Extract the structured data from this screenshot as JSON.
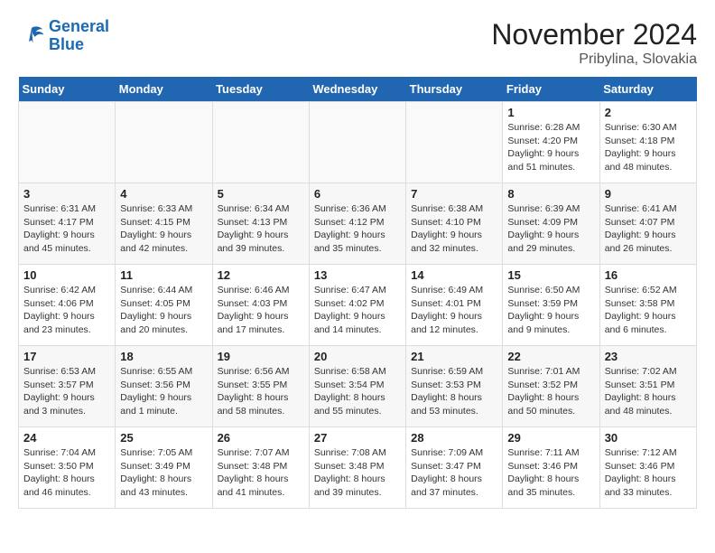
{
  "header": {
    "logo_line1": "General",
    "logo_line2": "Blue",
    "month_year": "November 2024",
    "location": "Pribylina, Slovakia"
  },
  "columns": [
    "Sunday",
    "Monday",
    "Tuesday",
    "Wednesday",
    "Thursday",
    "Friday",
    "Saturday"
  ],
  "weeks": [
    [
      {
        "day": "",
        "info": ""
      },
      {
        "day": "",
        "info": ""
      },
      {
        "day": "",
        "info": ""
      },
      {
        "day": "",
        "info": ""
      },
      {
        "day": "",
        "info": ""
      },
      {
        "day": "1",
        "info": "Sunrise: 6:28 AM\nSunset: 4:20 PM\nDaylight: 9 hours\nand 51 minutes."
      },
      {
        "day": "2",
        "info": "Sunrise: 6:30 AM\nSunset: 4:18 PM\nDaylight: 9 hours\nand 48 minutes."
      }
    ],
    [
      {
        "day": "3",
        "info": "Sunrise: 6:31 AM\nSunset: 4:17 PM\nDaylight: 9 hours\nand 45 minutes."
      },
      {
        "day": "4",
        "info": "Sunrise: 6:33 AM\nSunset: 4:15 PM\nDaylight: 9 hours\nand 42 minutes."
      },
      {
        "day": "5",
        "info": "Sunrise: 6:34 AM\nSunset: 4:13 PM\nDaylight: 9 hours\nand 39 minutes."
      },
      {
        "day": "6",
        "info": "Sunrise: 6:36 AM\nSunset: 4:12 PM\nDaylight: 9 hours\nand 35 minutes."
      },
      {
        "day": "7",
        "info": "Sunrise: 6:38 AM\nSunset: 4:10 PM\nDaylight: 9 hours\nand 32 minutes."
      },
      {
        "day": "8",
        "info": "Sunrise: 6:39 AM\nSunset: 4:09 PM\nDaylight: 9 hours\nand 29 minutes."
      },
      {
        "day": "9",
        "info": "Sunrise: 6:41 AM\nSunset: 4:07 PM\nDaylight: 9 hours\nand 26 minutes."
      }
    ],
    [
      {
        "day": "10",
        "info": "Sunrise: 6:42 AM\nSunset: 4:06 PM\nDaylight: 9 hours\nand 23 minutes."
      },
      {
        "day": "11",
        "info": "Sunrise: 6:44 AM\nSunset: 4:05 PM\nDaylight: 9 hours\nand 20 minutes."
      },
      {
        "day": "12",
        "info": "Sunrise: 6:46 AM\nSunset: 4:03 PM\nDaylight: 9 hours\nand 17 minutes."
      },
      {
        "day": "13",
        "info": "Sunrise: 6:47 AM\nSunset: 4:02 PM\nDaylight: 9 hours\nand 14 minutes."
      },
      {
        "day": "14",
        "info": "Sunrise: 6:49 AM\nSunset: 4:01 PM\nDaylight: 9 hours\nand 12 minutes."
      },
      {
        "day": "15",
        "info": "Sunrise: 6:50 AM\nSunset: 3:59 PM\nDaylight: 9 hours\nand 9 minutes."
      },
      {
        "day": "16",
        "info": "Sunrise: 6:52 AM\nSunset: 3:58 PM\nDaylight: 9 hours\nand 6 minutes."
      }
    ],
    [
      {
        "day": "17",
        "info": "Sunrise: 6:53 AM\nSunset: 3:57 PM\nDaylight: 9 hours\nand 3 minutes."
      },
      {
        "day": "18",
        "info": "Sunrise: 6:55 AM\nSunset: 3:56 PM\nDaylight: 9 hours\nand 1 minute."
      },
      {
        "day": "19",
        "info": "Sunrise: 6:56 AM\nSunset: 3:55 PM\nDaylight: 8 hours\nand 58 minutes."
      },
      {
        "day": "20",
        "info": "Sunrise: 6:58 AM\nSunset: 3:54 PM\nDaylight: 8 hours\nand 55 minutes."
      },
      {
        "day": "21",
        "info": "Sunrise: 6:59 AM\nSunset: 3:53 PM\nDaylight: 8 hours\nand 53 minutes."
      },
      {
        "day": "22",
        "info": "Sunrise: 7:01 AM\nSunset: 3:52 PM\nDaylight: 8 hours\nand 50 minutes."
      },
      {
        "day": "23",
        "info": "Sunrise: 7:02 AM\nSunset: 3:51 PM\nDaylight: 8 hours\nand 48 minutes."
      }
    ],
    [
      {
        "day": "24",
        "info": "Sunrise: 7:04 AM\nSunset: 3:50 PM\nDaylight: 8 hours\nand 46 minutes."
      },
      {
        "day": "25",
        "info": "Sunrise: 7:05 AM\nSunset: 3:49 PM\nDaylight: 8 hours\nand 43 minutes."
      },
      {
        "day": "26",
        "info": "Sunrise: 7:07 AM\nSunset: 3:48 PM\nDaylight: 8 hours\nand 41 minutes."
      },
      {
        "day": "27",
        "info": "Sunrise: 7:08 AM\nSunset: 3:48 PM\nDaylight: 8 hours\nand 39 minutes."
      },
      {
        "day": "28",
        "info": "Sunrise: 7:09 AM\nSunset: 3:47 PM\nDaylight: 8 hours\nand 37 minutes."
      },
      {
        "day": "29",
        "info": "Sunrise: 7:11 AM\nSunset: 3:46 PM\nDaylight: 8 hours\nand 35 minutes."
      },
      {
        "day": "30",
        "info": "Sunrise: 7:12 AM\nSunset: 3:46 PM\nDaylight: 8 hours\nand 33 minutes."
      }
    ]
  ]
}
